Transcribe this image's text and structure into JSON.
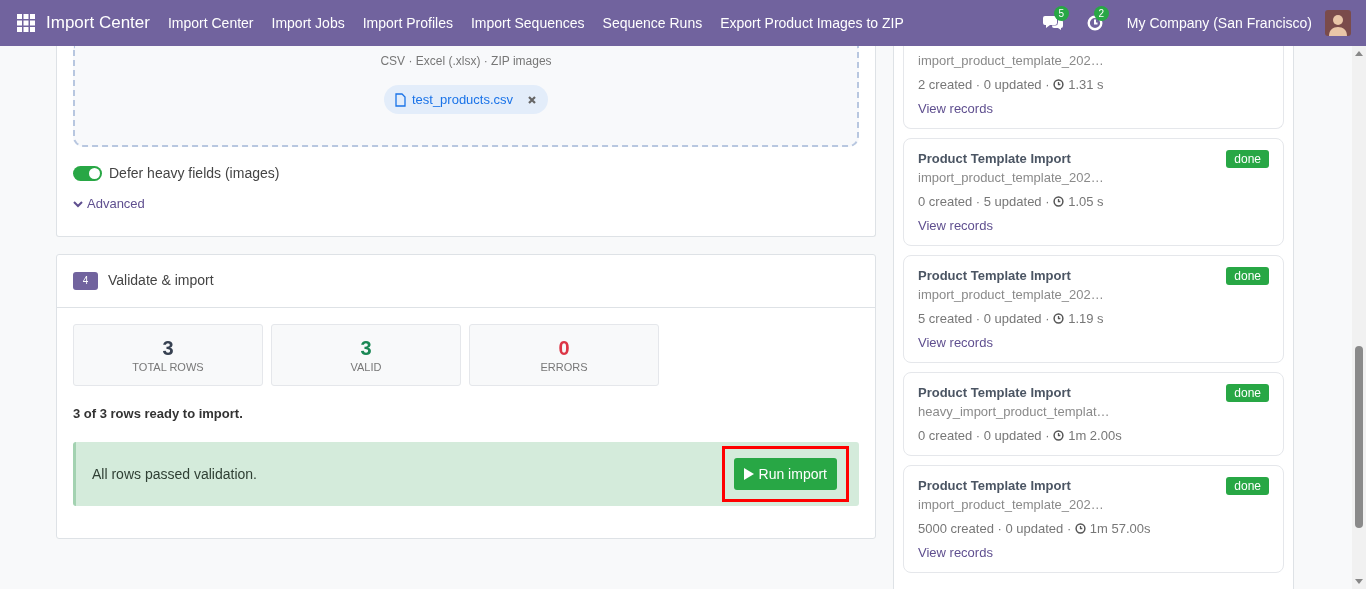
{
  "app": {
    "title": "Import Center"
  },
  "nav": [
    "Import Center",
    "Import Jobs",
    "Import Profiles",
    "Import Sequences",
    "Sequence Runs",
    "Export Product Images to ZIP"
  ],
  "notifications": {
    "messages": "5",
    "activities": "2"
  },
  "company": "My Company (San Francisco)",
  "upload": {
    "hint": "CSV · Excel (.xlsx) · ZIP images",
    "file": "test_products.csv",
    "defer_heavy": {
      "label": "Defer heavy fields (images)",
      "on": true
    },
    "advanced": {
      "label": "Advanced",
      "expanded": false
    }
  },
  "validate": {
    "step": "4",
    "title": "Validate & import",
    "stats": [
      {
        "value": "3",
        "label": "TOTAL ROWS",
        "kind": "neutral"
      },
      {
        "value": "3",
        "label": "VALID",
        "kind": "success"
      },
      {
        "value": "0",
        "label": "ERRORS",
        "kind": "danger"
      }
    ],
    "summary": "3 of 3 rows ready to import.",
    "alert": "All rows passed validation.",
    "button": {
      "label": "Run import",
      "highlighted": true
    }
  },
  "jobs": [
    {
      "file": "import_product_template_202…",
      "stats": "2 created · 0 updated · ",
      "time": "1.31 s",
      "link": "View records"
    },
    {
      "title": "Product Template Import",
      "status": "done",
      "file": "import_product_template_202…",
      "stats": "0 created · 5 updated · ",
      "time": "1.05 s",
      "link": "View records"
    },
    {
      "title": "Product Template Import",
      "status": "done",
      "file": "import_product_template_202…",
      "stats": "5 created · 0 updated · ",
      "time": "1.19 s",
      "link": "View records"
    },
    {
      "title": "Product Template Import",
      "status": "done",
      "file": "heavy_import_product_templat…",
      "stats": "0 created · 0 updated · ",
      "time": "1m 2.00s"
    },
    {
      "title": "Product Template Import",
      "status": "done",
      "file": "import_product_template_202…",
      "stats": "5000 created · 0 updated · ",
      "time": "1m 57.00s",
      "link": "View records"
    }
  ]
}
